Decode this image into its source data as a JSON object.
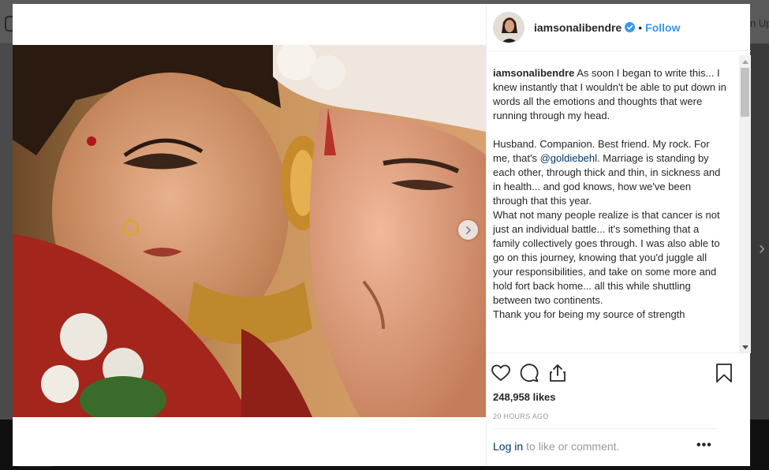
{
  "backdrop": {
    "signup_fragment": "n Up"
  },
  "post": {
    "username": "iamsonalibendre",
    "verified_icon": "verified-badge-icon",
    "separator": "•",
    "follow_label": "Follow",
    "caption": {
      "username": "iamsonalibendre",
      "paragraph_1": "As soon I began to write this... I knew instantly that I wouldn't be able to put down in words all the emotions and thoughts that were running through my head.",
      "paragraph_2_before": "Husband. Companion. Best friend. My rock. For me, that's ",
      "mention": "@goldiebehl",
      "paragraph_2_after": ". Marriage is standing by each other, through thick and thin, in sickness and in health... and god knows, how we've been through that this year.",
      "paragraph_3": "What not many people realize is that cancer is not just an individual battle... it's something that a family collectively goes through. I was also able to go on this journey, knowing that you'd juggle all your responsibilities, and take on some more and hold fort back home... all this while shuttling between two continents.",
      "paragraph_4_partial": "Thank you for being my source of strength"
    },
    "likes": "248,958 likes",
    "timestamp": "20 HOURS AGO",
    "comment_bar": {
      "login_label": "Log in",
      "rest_label": "to like or comment."
    },
    "more_label": "•••",
    "icons": {
      "like": "heart-icon",
      "comment": "comment-icon",
      "share": "share-icon",
      "save": "bookmark-icon",
      "next": "chevron-right-icon"
    }
  },
  "colors": {
    "link_blue": "#3897f0",
    "mention_blue": "#003569",
    "text": "#262626",
    "muted": "#999999"
  }
}
